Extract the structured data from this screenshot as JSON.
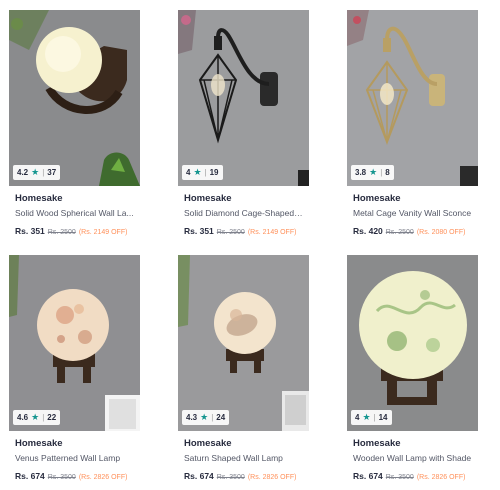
{
  "products": [
    {
      "brand": "Homesake",
      "name": "Solid Wood Spherical Wall La...",
      "rating": "4.2",
      "rating_count": "37",
      "price": "Rs. 351",
      "mrp": "Rs. 2500",
      "discount": "(Rs. 2149 OFF)"
    },
    {
      "brand": "Homesake",
      "name": "Solid Diamond Cage-Shaped ...",
      "rating": "4",
      "rating_count": "19",
      "price": "Rs. 351",
      "mrp": "Rs. 2500",
      "discount": "(Rs. 2149 OFF)"
    },
    {
      "brand": "Homesake",
      "name": "Metal Cage Vanity Wall Sconce",
      "rating": "3.8",
      "rating_count": "8",
      "price": "Rs. 420",
      "mrp": "Rs. 2500",
      "discount": "(Rs. 2080 OFF)"
    },
    {
      "brand": "Homesake",
      "name": "Venus Patterned Wall Lamp",
      "rating": "4.6",
      "rating_count": "22",
      "price": "Rs. 674",
      "mrp": "Rs. 3500",
      "discount": "(Rs. 2826 OFF)"
    },
    {
      "brand": "Homesake",
      "name": "Saturn Shaped Wall Lamp",
      "rating": "4.3",
      "rating_count": "24",
      "price": "Rs. 674",
      "mrp": "Rs. 3500",
      "discount": "(Rs. 2826 OFF)"
    },
    {
      "brand": "Homesake",
      "name": "Wooden Wall Lamp with Shade",
      "rating": "4",
      "rating_count": "14",
      "price": "Rs. 674",
      "mrp": "Rs. 3500",
      "discount": "(Rs. 2826 OFF)"
    }
  ],
  "icons": {
    "rating": "star-icon"
  },
  "colors": {
    "rating_star": "#14958f",
    "discount": "#ff905a",
    "brand_text": "#282c3f"
  }
}
